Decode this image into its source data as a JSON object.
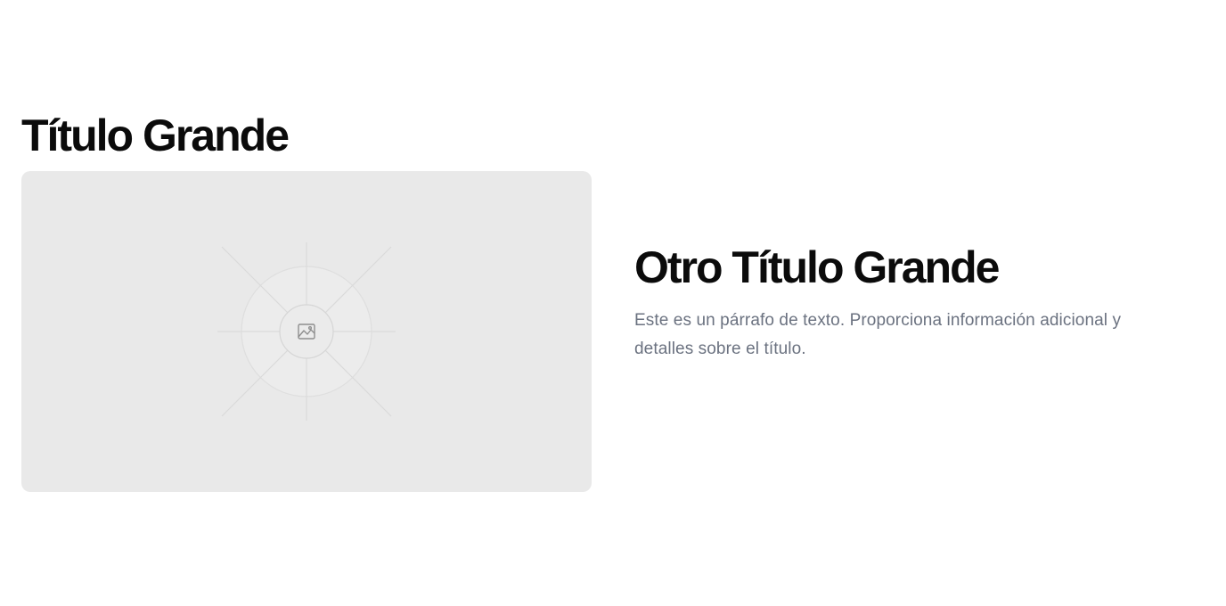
{
  "hero": {
    "title": "Título Grande",
    "image_placeholder": {
      "icon": "image-icon",
      "background_color": "#e9e9e9"
    }
  },
  "feature": {
    "title": "Otro Título Grande",
    "paragraph": "Este es un párrafo de texto. Proporciona información adicional y detalles sobre el título."
  },
  "colors": {
    "heading": "#0b0b0b",
    "body_text": "#6b7280",
    "placeholder_bg": "#e9e9e9"
  }
}
